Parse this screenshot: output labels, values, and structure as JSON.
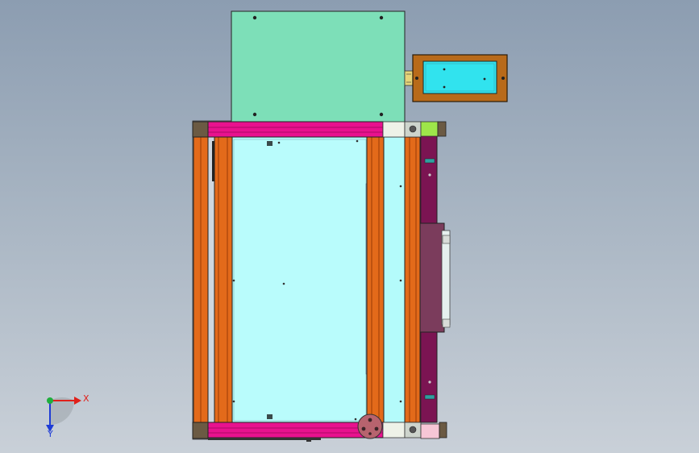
{
  "colors": {
    "background_top": "#8c9db1",
    "background_bottom": "#c9d0d8",
    "control_box": "#7ddfb8",
    "display_housing": "#b86a1a",
    "display_screen": "#31e3ee",
    "frame_bar": "#e8128e",
    "rail": "#e36a1a",
    "work_area": "#b4fbfb",
    "side_channel": "#7b1452",
    "motor_block": "#7b3c5c",
    "corner_block": "#6b5a43",
    "x_axis": "#e0201a",
    "y_axis": "#1e3cd6",
    "z_axis": "#1fae3c"
  },
  "triad": {
    "x_label": "X",
    "y_label": "Y"
  }
}
